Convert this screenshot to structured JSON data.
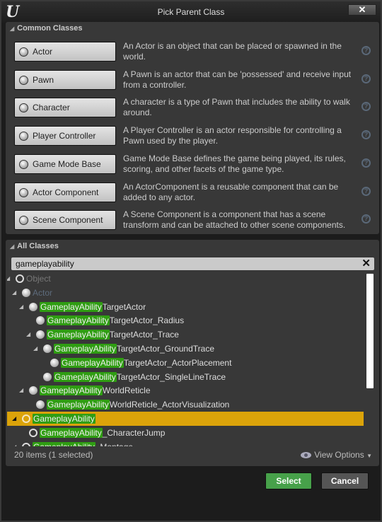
{
  "window": {
    "title": "Pick Parent Class",
    "logo": "U",
    "close": "✕"
  },
  "common": {
    "header": "Common Classes",
    "items": [
      {
        "label": "Actor",
        "icon": "actor-icon",
        "desc": "An Actor is an object that can be placed or spawned in the world."
      },
      {
        "label": "Pawn",
        "icon": "pawn-icon",
        "desc": "A Pawn is an actor that can be 'possessed' and receive input from a controller."
      },
      {
        "label": "Character",
        "icon": "character-icon",
        "desc": "A character is a type of Pawn that includes the ability to walk around."
      },
      {
        "label": "Player Controller",
        "icon": "player-controller-icon",
        "desc": "A Player Controller is an actor responsible for controlling a Pawn used by the player."
      },
      {
        "label": "Game Mode Base",
        "icon": "game-mode-icon",
        "desc": "Game Mode Base defines the game being played, its rules, scoring, and other facets of the game type."
      },
      {
        "label": "Actor Component",
        "icon": "actor-component-icon",
        "desc": "An ActorComponent is a reusable component that can be added to any actor."
      },
      {
        "label": "Scene Component",
        "icon": "scene-component-icon",
        "desc": "A Scene Component is a component that has a scene transform and can be attached to other scene components."
      }
    ]
  },
  "all": {
    "header": "All Classes",
    "search_value": "gameplayability",
    "tree": [
      {
        "level": 0,
        "arrow": true,
        "icon": "ring",
        "match": "",
        "rest": "Object",
        "style": "dim"
      },
      {
        "level": 1,
        "arrow": true,
        "icon": "sphere",
        "match": "",
        "rest": "Actor",
        "style": "dimblue"
      },
      {
        "level": 2,
        "arrow": true,
        "icon": "sphere",
        "match": "GameplayAbility",
        "rest": "TargetActor"
      },
      {
        "level": 3,
        "arrow": false,
        "icon": "sphere",
        "match": "GameplayAbility",
        "rest": "TargetActor_Radius"
      },
      {
        "level": 3,
        "arrow": true,
        "icon": "sphere",
        "match": "GameplayAbility",
        "rest": "TargetActor_Trace"
      },
      {
        "level": 4,
        "arrow": true,
        "icon": "sphere",
        "match": "GameplayAbility",
        "rest": "TargetActor_GroundTrace"
      },
      {
        "level": 5,
        "arrow": false,
        "icon": "sphere",
        "match": "GameplayAbility",
        "rest": "TargetActor_ActorPlacement"
      },
      {
        "level": 4,
        "arrow": false,
        "icon": "sphere",
        "match": "GameplayAbility",
        "rest": "TargetActor_SingleLineTrace"
      },
      {
        "level": 2,
        "arrow": true,
        "icon": "sphere",
        "match": "GameplayAbility",
        "rest": "WorldReticle"
      },
      {
        "level": 3,
        "arrow": false,
        "icon": "sphere",
        "match": "GameplayAbility",
        "rest": "WorldReticle_ActorVisualization"
      },
      {
        "level": 1,
        "arrow": true,
        "icon": "ring",
        "match": "GameplayAbility",
        "rest": "",
        "selected": true
      },
      {
        "level": 2,
        "arrow": false,
        "icon": "ring",
        "match": "GameplayAbility",
        "rest": "_CharacterJump"
      },
      {
        "level": 1,
        "arrow": true,
        "icon": "ring",
        "match": "GameplayAbility",
        "rest": "_Montage"
      }
    ],
    "status": "20 items (1 selected)",
    "view_options": "View Options"
  },
  "buttons": {
    "select": "Select",
    "cancel": "Cancel"
  },
  "colors": {
    "highlight": "#2f9d12",
    "selection": "#dba30a",
    "select_button": "#47a14a"
  }
}
